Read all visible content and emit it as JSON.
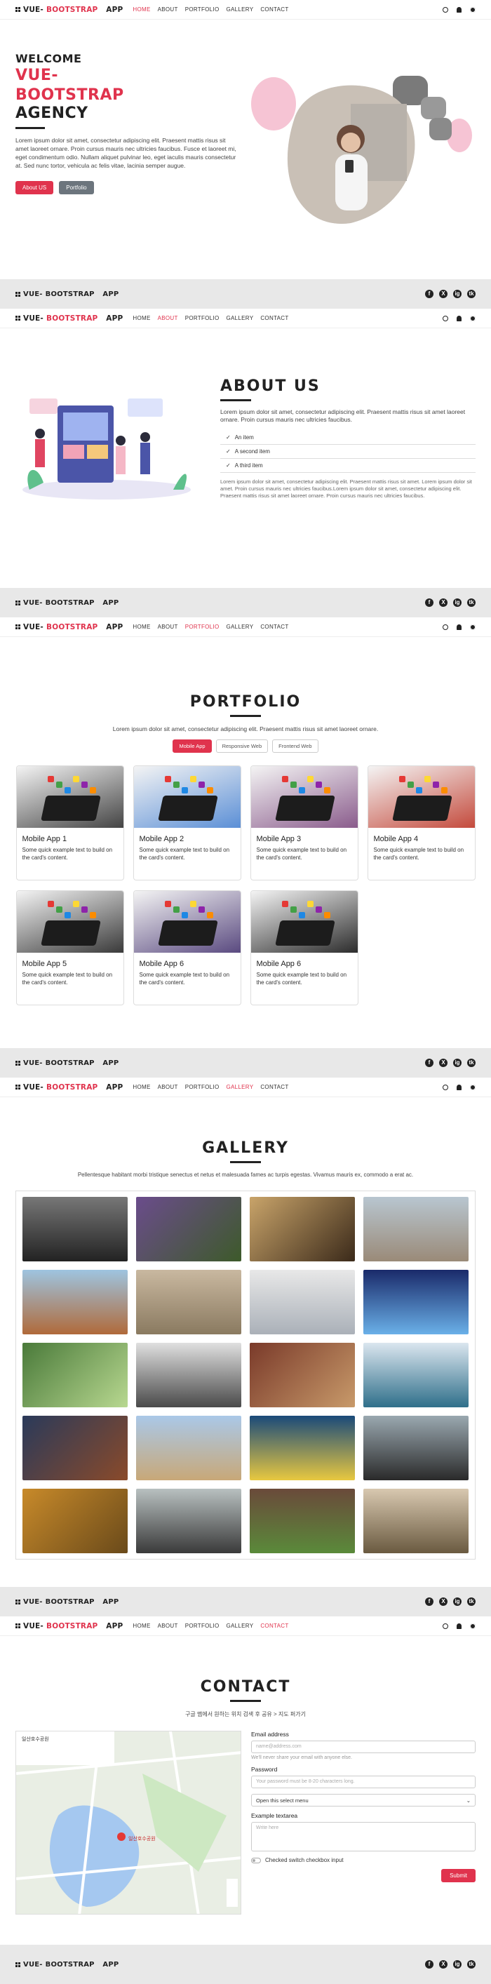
{
  "brand": {
    "part1": "VUE-",
    "part2": "BOOTSTRAP",
    "part3": "APP"
  },
  "nav": [
    "HOME",
    "ABOUT",
    "PORTFOLIO",
    "GALLERY",
    "CONTACT"
  ],
  "social": [
    "f",
    "X",
    "ig",
    "tk"
  ],
  "hero": {
    "welcome": "WELCOME",
    "vue": "VUE-",
    "bootstrap": "BOOTSTRAP",
    "agency": "AGENCY",
    "text": "Lorem ipsum dolor sit amet, consectetur adipiscing elit. Praesent mattis risus sit amet laoreet ornare. Proin cursus mauris nec ultricies faucibus. Fusce et laoreet mi, eget condimentum odio. Nullam aliquet pulvinar leo, eget iaculis mauris consectetur at. Sed nunc tortor, vehicula ac felis vitae, lacinia semper augue.",
    "btn_about": "About US",
    "btn_portfolio": "Portfolio"
  },
  "about": {
    "title": "ABOUT US",
    "text": "Lorem ipsum dolor sit amet, consectetur adipiscing elit. Praesent mattis risus sit amet laoreet ornare. Proin cursus mauris nec ultricies faucibus.",
    "items": [
      "An item",
      "A second item",
      "A third item"
    ],
    "small": "Lorem ipsum dolor sit amet, consectetur adipiscing elit. Praesent mattis risus sit amet. Lorem ipsum dolor sit amet. Proin cursus mauris nec ultricies faucibus.Lorem ipsum dolor sit amet, consectetur adipiscing elit. Praesent mattis risus sit amet laoreet ornare. Proin cursus mauris nec ultricies faucibus."
  },
  "portfolio": {
    "title": "PORTFOLIO",
    "lead": "Lorem ipsum dolor sit amet, consectetur adipiscing elit. Praesent mattis risus sit amet laoreet ornare.",
    "filters": [
      "Mobile App",
      "Responsive Web",
      "Frontend Web"
    ],
    "cards": [
      {
        "title": "Mobile App 1",
        "text": "Some quick example text to build on the card's content."
      },
      {
        "title": "Mobile App 2",
        "text": "Some quick example text to build on the card's content."
      },
      {
        "title": "Mobile App 3",
        "text": "Some quick example text to build on the card's content."
      },
      {
        "title": "Mobile App 4",
        "text": "Some quick example text to build on the card's content."
      },
      {
        "title": "Mobile App 5",
        "text": "Some quick example text to build on the card's content."
      },
      {
        "title": "Mobile App 6",
        "text": "Some quick example text to build on the card's content."
      },
      {
        "title": "Mobile App 6",
        "text": "Some quick example text to build on the card's content."
      }
    ]
  },
  "gallery": {
    "title": "GALLERY",
    "lead": "Pellentesque habitant morbi tristique senectus et netus et malesuada fames ac turpis egestas. Vivamus mauris ex, commodo a erat ac."
  },
  "contact": {
    "title": "CONTACT",
    "lead": "구글 맵에서 원하는 위치 검색 후 공유 > 지도 퍼가기",
    "email_label": "Email address",
    "email_ph": "name@address.com",
    "email_help": "We'll never share your email with anyone else.",
    "pw_label": "Password",
    "pw_ph": "Your password must be 8-20 characters long.",
    "select": "Open this select menu",
    "ta_label": "Example textarea",
    "ta_ph": "Write here",
    "switch": "Checked switch checkbox input",
    "submit": "Submit",
    "map_place": "일산호수공원",
    "map_label": "일산호수공원"
  }
}
